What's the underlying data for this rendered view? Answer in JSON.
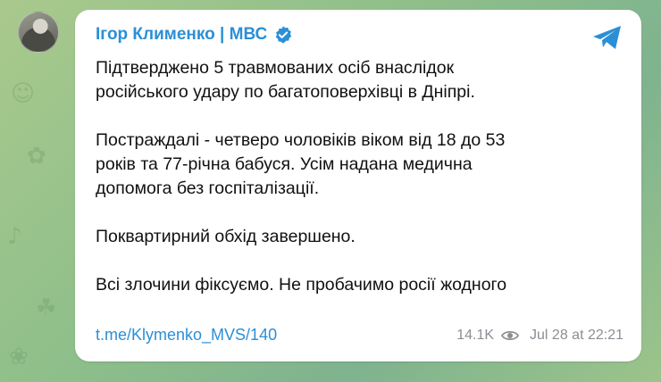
{
  "post": {
    "channel": "Ігор Клименко | МВС",
    "paragraphs": [
      "Підтверджено 5 травмованих осіб внаслідок\nросійського удару по багатоповерхівці в Дніпрі.",
      "Постраждалі - четверо чоловіків віком від 18 до 53\nроків та 77-річна бабуся. Усім надана медична\nдопомога без госпіталізації.",
      "Поквартирний обхід завершено.",
      "Всі злочини фіксуємо. Не пробачимо росії жодного"
    ],
    "link": "t.me/Klymenko_MVS/140",
    "views": "14.1K",
    "timestamp": "Jul 28 at 22:21"
  },
  "colors": {
    "accent": "#2b8fd6",
    "meta": "#8a8f95"
  },
  "icons": [
    "avatar",
    "verified-icon",
    "telegram-share-icon",
    "eye-icon"
  ]
}
